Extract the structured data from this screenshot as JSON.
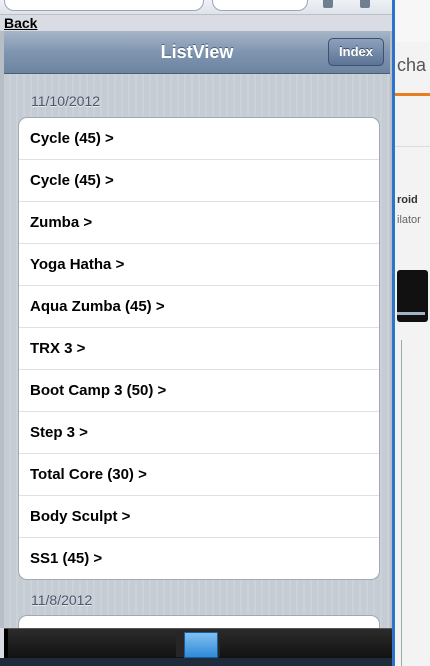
{
  "nav": {
    "back_label": "Back"
  },
  "header": {
    "title": "ListView",
    "index_button": "Index"
  },
  "groups": [
    {
      "date": "11/10/2012",
      "items": [
        "Cycle (45) >",
        "Cycle (45) >",
        "Zumba >",
        "Yoga Hatha >",
        "Aqua Zumba (45) >",
        "TRX 3 >",
        "Boot Camp 3 (50) >",
        "Step 3 >",
        "Total Core (30) >",
        "Body Sculpt >",
        "SS1 (45) >"
      ]
    },
    {
      "date": "11/8/2012",
      "items": []
    }
  ],
  "background_window": {
    "heading_fragment": "cha",
    "title_fragment": "roid",
    "subtitle_fragment": "ilator"
  },
  "colors": {
    "header_bar": "#7f95b0",
    "frame_border": "#2c73c9",
    "accent_orange": "#e67e22",
    "toolbar_highlight": "#2f8ad8"
  }
}
